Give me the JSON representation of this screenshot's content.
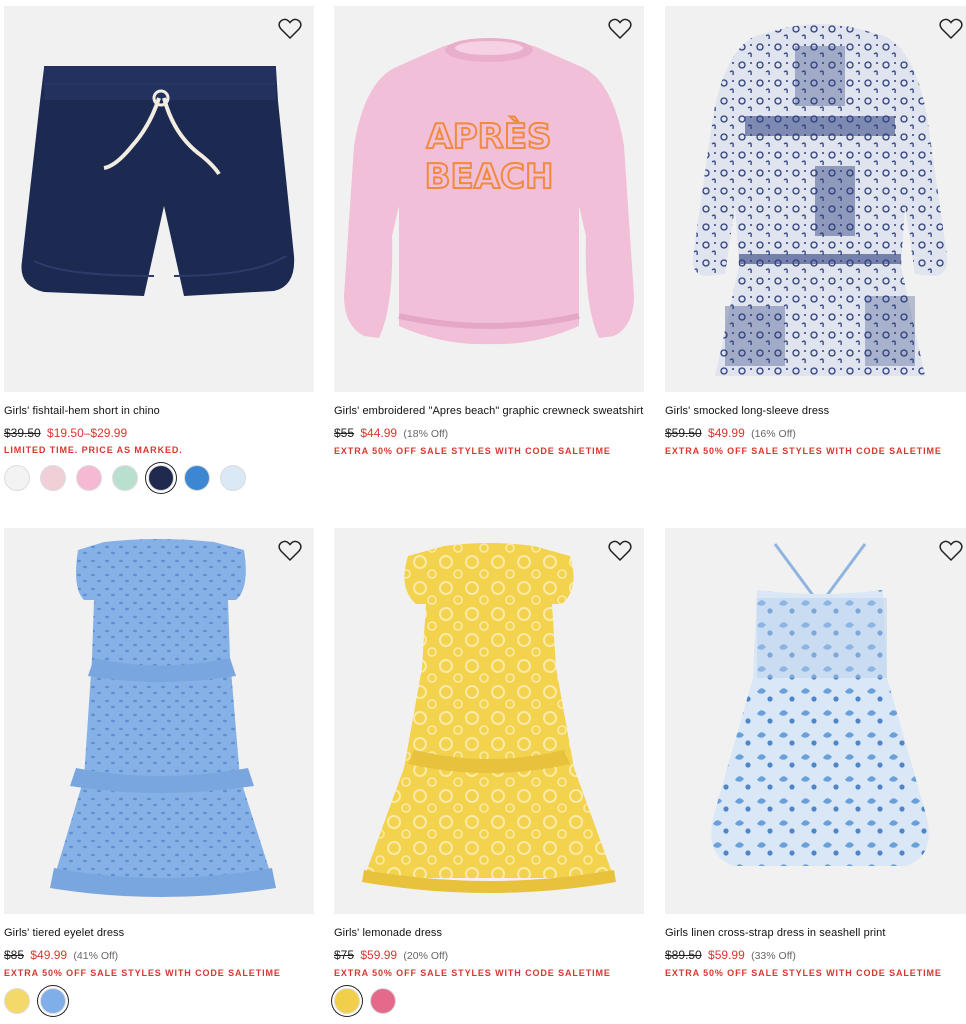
{
  "products": [
    {
      "name": "Girls' fishtail-hem short in chino",
      "was": "$39.50",
      "now": "$19.50–$29.99",
      "pct": "",
      "promo": "LIMITED TIME. PRICE AS MARKED.",
      "swatches": [
        "#f3f3f3",
        "#f0cfd6",
        "#f5b9d3",
        "#b9e0cf",
        "#1f2a4e",
        "#3c86d2",
        "#dbe8f6"
      ],
      "selected_swatch": 4
    },
    {
      "name": "Girls' embroidered \"Apres beach\" graphic crewneck sweatshirt",
      "was": "$55",
      "now": "$44.99",
      "pct": "(18% Off)",
      "promo": "EXTRA 50% OFF SALE STYLES WITH CODE SALETIME",
      "swatches": [],
      "graphic_text": [
        "APRÈS",
        "BEACH"
      ]
    },
    {
      "name": "Girls' smocked long-sleeve dress",
      "was": "$59.50",
      "now": "$49.99",
      "pct": "(16% Off)",
      "promo": "EXTRA 50% OFF SALE STYLES WITH CODE SALETIME",
      "swatches": []
    },
    {
      "name": "Girls' tiered eyelet dress",
      "was": "$85",
      "now": "$49.99",
      "pct": "(41% Off)",
      "promo": "EXTRA 50% OFF SALE STYLES WITH CODE SALETIME",
      "swatches": [
        "#f2d96a",
        "#7faee8"
      ],
      "selected_swatch": 1
    },
    {
      "name": "Girls' lemonade dress",
      "was": "$75",
      "now": "$59.99",
      "pct": "(20% Off)",
      "promo": "EXTRA 50% OFF SALE STYLES WITH CODE SALETIME",
      "swatches": [
        "#f2cf4a",
        "#e36a8a"
      ],
      "selected_swatch": 0
    },
    {
      "name": "Girls linen cross-strap dress in seashell print",
      "was": "$89.50",
      "now": "$59.99",
      "pct": "(33% Off)",
      "promo": "EXTRA 50% OFF SALE STYLES WITH CODE SALETIME",
      "swatches": []
    }
  ],
  "colors": {
    "sale_red": "#d8372f",
    "image_bg": "#f1f1f1"
  },
  "icons": {
    "favorite": "heart-outline-icon"
  }
}
